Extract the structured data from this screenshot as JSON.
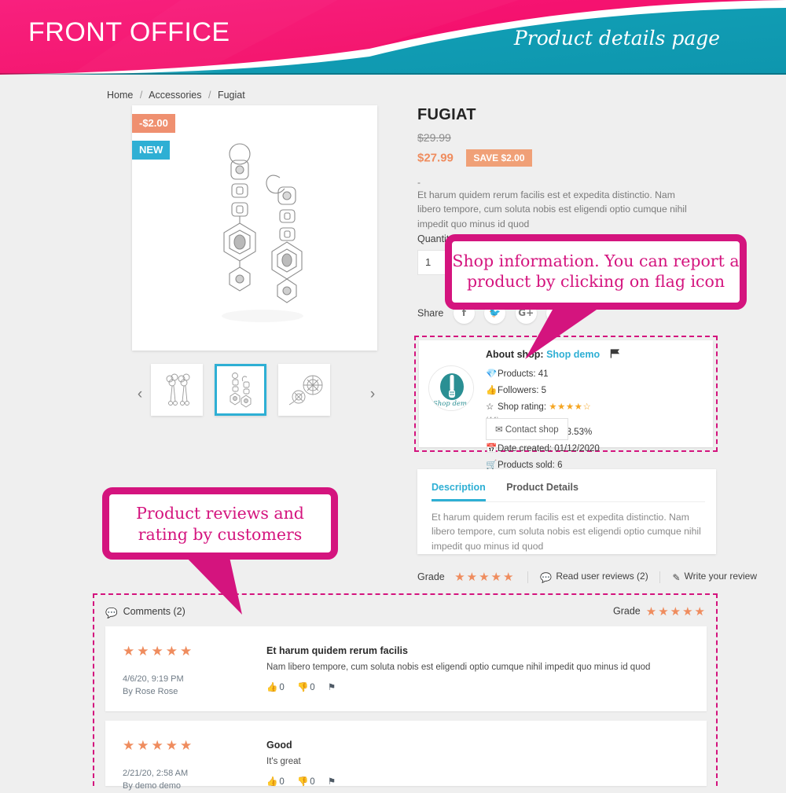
{
  "banner": {
    "left_label": "FRONT OFFICE",
    "right_label": "Product details page",
    "pink": "#F4106C",
    "teal": "#119DB4"
  },
  "breadcrumb": {
    "items": [
      "Home",
      "Accessories",
      "Fugiat"
    ],
    "separator": "/"
  },
  "product": {
    "title": "FUGIAT",
    "price_old": "$29.99",
    "price_new": "$27.99",
    "save_badge": "SAVE $2.00",
    "discount_flag": "-$2.00",
    "new_flag": "NEW",
    "tiny_text": "-",
    "description": "Et harum quidem rerum facilis est et expedita distinctio. Nam libero tempore, cum soluta nobis est eligendi optio cumque nihil impedit quo minus id quod",
    "quantity_label": "Quantity",
    "quantity_value": "1",
    "share_label": "Share",
    "share_buttons": [
      "facebook-icon",
      "twitter-icon",
      "google-plus-icon",
      "pinterest-icon"
    ]
  },
  "thumbnails": {
    "prev": "‹",
    "next": "›",
    "items": [
      "thumbnail-1",
      "thumbnail-2",
      "thumbnail-3"
    ],
    "selected_index": 1
  },
  "shop": {
    "about_label": "About shop:",
    "name": "Shop demo",
    "flag_icon": "flag-icon",
    "logo_text": "Shop demo",
    "stats_left": [
      {
        "icon": "products-icon",
        "text": "Products: 41"
      },
      {
        "icon": "thumbs-up-icon",
        "text": "Followers: 5"
      }
    ],
    "rating_label": "Shop rating:",
    "rating_stars": "★★★★",
    "rating_half": "☆",
    "rating_count": "(44)",
    "stats_right": [
      {
        "icon": "comment-icon",
        "text": "Response rate: 23.53%"
      },
      {
        "icon": "calendar-icon",
        "text": "Date created: 01/12/2020"
      },
      {
        "icon": "cart-icon",
        "text": "Products sold: 6"
      }
    ],
    "contact_button": "Contact shop"
  },
  "tabs": {
    "items": [
      {
        "label": "Description",
        "active": true
      },
      {
        "label": "Product Details",
        "active": false
      }
    ],
    "body": "Et harum quidem rerum facilis est et expedita distinctio. Nam libero tempore, cum soluta nobis est eligendi optio cumque nihil impedit quo minus id quod"
  },
  "grade_row": {
    "label": "Grade",
    "stars": "★★★★★",
    "read_reviews": "Read user reviews (2)",
    "write_review": "Write your review"
  },
  "comments": {
    "heading": "Comments (2)",
    "grade_label": "Grade",
    "grade_stars": "★★★★★",
    "items": [
      {
        "stars": "★★★★★",
        "date": "4/6/20, 9:19 PM",
        "author": "By Rose Rose",
        "title": "Et harum quidem rerum facilis",
        "body": "Nam libero tempore, cum soluta nobis est eligendi optio cumque nihil impedit quo minus id quod",
        "up_count": "0",
        "down_count": "0"
      },
      {
        "stars": "★★★★★",
        "date": "2/21/20, 2:58 AM",
        "author": "By demo demo",
        "title": "Good",
        "body": "It's great",
        "up_count": "0",
        "down_count": "0"
      }
    ]
  },
  "callouts": {
    "shop": "Shop information. You can report a product by clicking on flag icon",
    "reviews": "Product reviews and rating by customers",
    "color": "#D4147E"
  }
}
